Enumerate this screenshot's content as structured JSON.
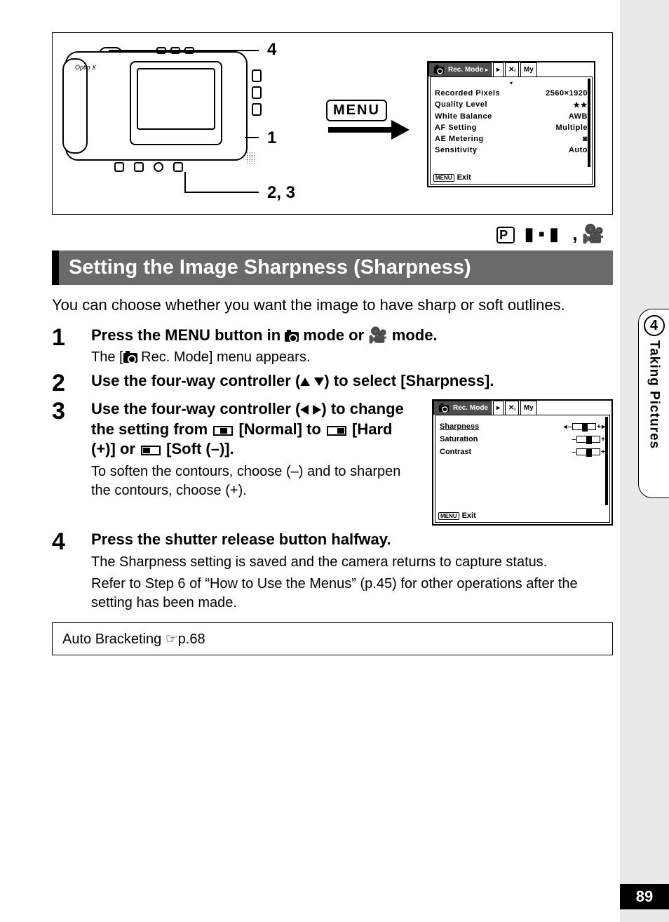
{
  "page_number": "89",
  "side_tab": {
    "chapter_number": "4",
    "chapter_title": "Taking Pictures"
  },
  "top_figure": {
    "camera_logo": "Optio X",
    "callouts": {
      "c1": "4",
      "c2": "1",
      "c3": "2, 3"
    },
    "menu_button_label": "MENU",
    "lcd1": {
      "tab_active": "Rec. Mode",
      "tab_my": "My",
      "rows": [
        {
          "label": "Recorded Pixels",
          "value": "2560×1920"
        },
        {
          "label": "Quality Level",
          "value": "★★"
        },
        {
          "label": "White Balance",
          "value": "AWB"
        },
        {
          "label": "AF Setting",
          "value": "Multiple"
        },
        {
          "label": "AE Metering",
          "value": "◙"
        },
        {
          "label": "Sensitivity",
          "value": "Auto"
        }
      ],
      "exit_menu": "MENU",
      "exit_label": "Exit"
    }
  },
  "mode_line": {
    "p": "P"
  },
  "heading": "Setting the Image Sharpness (Sharpness)",
  "intro": "You can choose whether you want the image to have sharp or soft outlines.",
  "steps": {
    "s1": {
      "num": "1",
      "title_a": "Press the ",
      "title_menu": "MENU",
      "title_b": " button in ",
      "title_c": " mode or ",
      "title_d": " mode.",
      "sub_a": "The [",
      "sub_b": " Rec. Mode] menu appears."
    },
    "s2": {
      "num": "2",
      "title_a": "Use the four-way controller (",
      "title_b": ") to select [Sharpness]."
    },
    "s3": {
      "num": "3",
      "title_a": "Use the four-way controller (",
      "title_b": ") to change the setting from ",
      "opt_normal": " [Normal] to ",
      "opt_hard": " [Hard (+)] or ",
      "opt_soft": " [Soft (–)].",
      "sub": "To soften the contours, choose (–) and to sharpen the contours, choose (+).",
      "lcd2": {
        "tab_active": "Rec. Mode",
        "tab_my": "My",
        "rows": [
          {
            "label": "Sharpness"
          },
          {
            "label": "Saturation"
          },
          {
            "label": "Contrast"
          }
        ],
        "exit_menu": "MENU",
        "exit_label": "Exit"
      }
    },
    "s4": {
      "num": "4",
      "title": "Press the shutter release button halfway.",
      "sub1": "The Sharpness setting is saved and the camera returns to capture status.",
      "sub2": "Refer to Step 6 of “How to Use the Menus” (p.45) for other operations after the setting has been made."
    }
  },
  "refbox": {
    "text": "Auto Bracketing ",
    "page": "☞p.68"
  }
}
